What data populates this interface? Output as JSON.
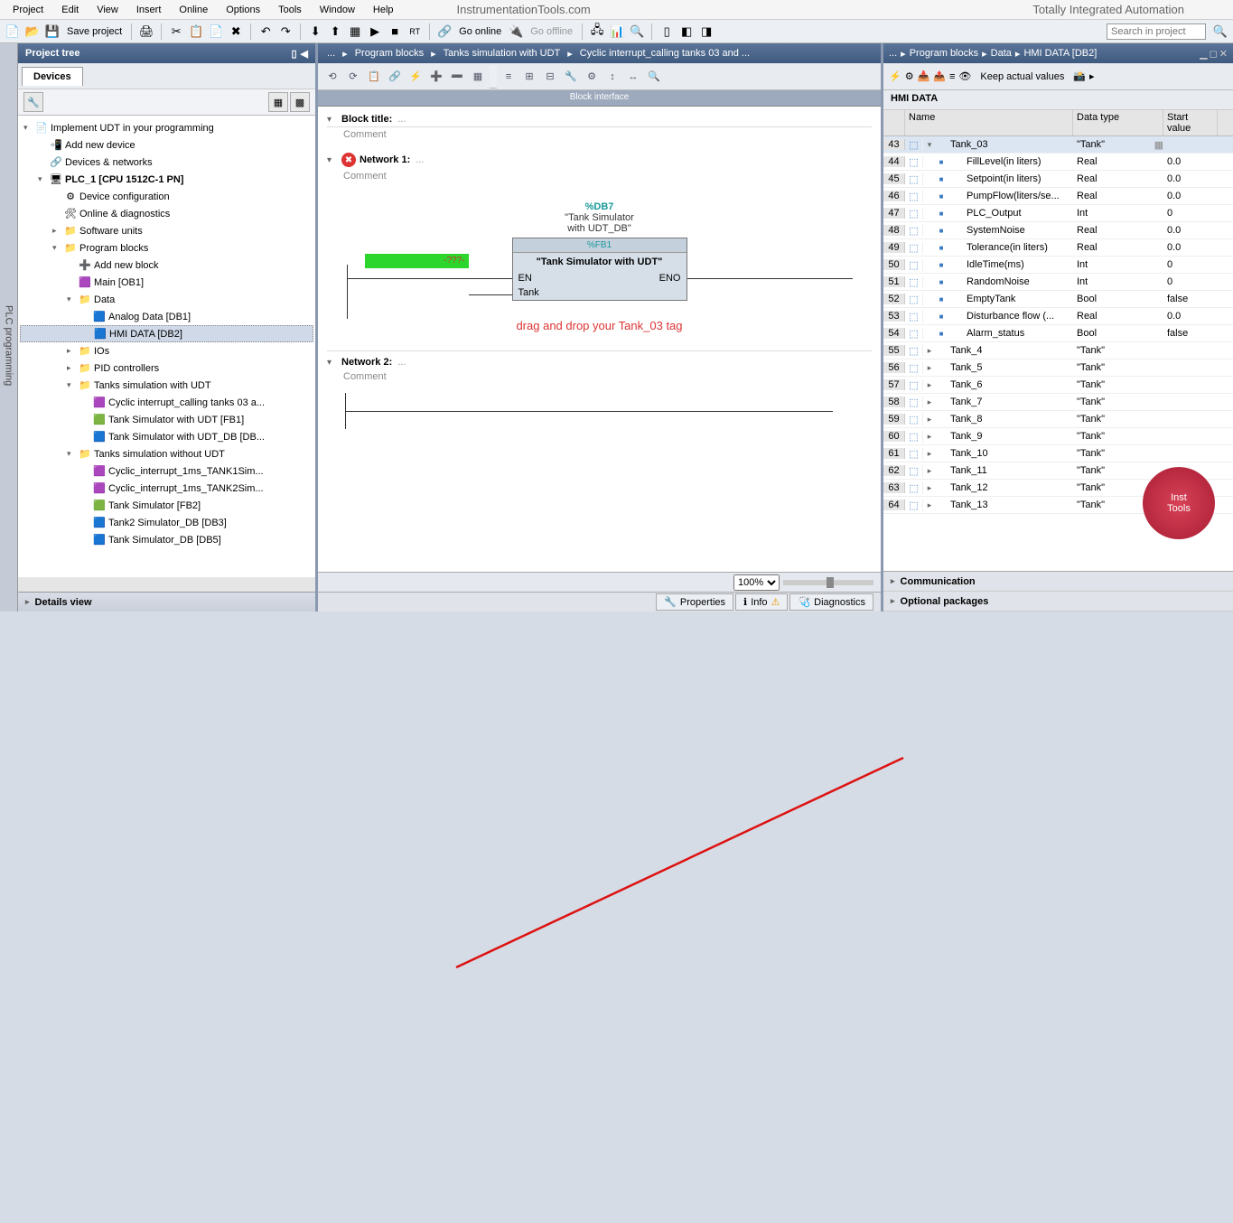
{
  "menu": [
    "Project",
    "Edit",
    "View",
    "Insert",
    "Online",
    "Options",
    "Tools",
    "Window",
    "Help"
  ],
  "site_title": "InstrumentationTools.com",
  "app_title": "Totally Integrated Automation",
  "toolbar": {
    "save": "Save project",
    "go_online": "Go online",
    "go_offline": "Go offline",
    "search_placeholder": "Search in project"
  },
  "left": {
    "title": "Project tree",
    "tab": "Devices",
    "details": "Details view",
    "tree": [
      {
        "d": 0,
        "exp": "▾",
        "icon": "📄",
        "label": "Implement UDT in your programming"
      },
      {
        "d": 1,
        "exp": "",
        "icon": "📲",
        "label": "Add new device"
      },
      {
        "d": 1,
        "exp": "",
        "icon": "🔗",
        "label": "Devices & networks"
      },
      {
        "d": 1,
        "exp": "▾",
        "icon": "🖥",
        "label": "PLC_1 [CPU 1512C-1 PN]",
        "bold": true
      },
      {
        "d": 2,
        "exp": "",
        "icon": "⚙",
        "label": "Device configuration"
      },
      {
        "d": 2,
        "exp": "",
        "icon": "🛠",
        "label": "Online & diagnostics"
      },
      {
        "d": 2,
        "exp": "▸",
        "icon": "📁",
        "label": "Software units"
      },
      {
        "d": 2,
        "exp": "▾",
        "icon": "📁",
        "label": "Program blocks"
      },
      {
        "d": 3,
        "exp": "",
        "icon": "➕",
        "label": "Add new block"
      },
      {
        "d": 3,
        "exp": "",
        "icon": "🟪",
        "label": "Main [OB1]"
      },
      {
        "d": 3,
        "exp": "▾",
        "icon": "📁",
        "label": "Data"
      },
      {
        "d": 4,
        "exp": "",
        "icon": "🟦",
        "label": "Analog Data [DB1]"
      },
      {
        "d": 4,
        "exp": "",
        "icon": "🟦",
        "label": "HMI DATA [DB2]",
        "selected": true
      },
      {
        "d": 3,
        "exp": "▸",
        "icon": "📁",
        "label": "IOs"
      },
      {
        "d": 3,
        "exp": "▸",
        "icon": "📁",
        "label": "PID controllers"
      },
      {
        "d": 3,
        "exp": "▾",
        "icon": "📁",
        "label": "Tanks simulation with UDT"
      },
      {
        "d": 4,
        "exp": "",
        "icon": "🟪",
        "label": "Cyclic interrupt_calling tanks 03 a..."
      },
      {
        "d": 4,
        "exp": "",
        "icon": "🟩",
        "label": "Tank Simulator with UDT [FB1]"
      },
      {
        "d": 4,
        "exp": "",
        "icon": "🟦",
        "label": "Tank Simulator with UDT_DB [DB..."
      },
      {
        "d": 3,
        "exp": "▾",
        "icon": "📁",
        "label": "Tanks simulation without UDT"
      },
      {
        "d": 4,
        "exp": "",
        "icon": "🟪",
        "label": "Cyclic_interrupt_1ms_TANK1Sim..."
      },
      {
        "d": 4,
        "exp": "",
        "icon": "🟪",
        "label": "Cyclic_interrupt_1ms_TANK2Sim..."
      },
      {
        "d": 4,
        "exp": "",
        "icon": "🟩",
        "label": "Tank Simulator [FB2]"
      },
      {
        "d": 4,
        "exp": "",
        "icon": "🟦",
        "label": "Tank2 Simulator_DB [DB3]"
      },
      {
        "d": 4,
        "exp": "",
        "icon": "🟦",
        "label": "Tank Simulator_DB [DB5]"
      }
    ]
  },
  "center": {
    "breadcrumb": [
      "...",
      "Program blocks",
      "Tanks simulation with UDT",
      "Cyclic interrupt_calling tanks 03 and ..."
    ],
    "block_interface": "Block interface",
    "block_title": "Block title:",
    "comment": "Comment",
    "net1": "Network 1:",
    "net2": "Network 2:",
    "db_tag": "%DB7",
    "db_name1": "\"Tank Simulator",
    "db_name2": "with UDT_DB\"",
    "fb_tag": "%FB1",
    "fb_name": "\"Tank Simulator with UDT\"",
    "en": "EN",
    "eno": "ENO",
    "tank": "Tank",
    "green": "-???-",
    "annotation": "drag and drop your Tank_03 tag",
    "zoom": "100%",
    "tabs": {
      "properties": "Properties",
      "info": "Info",
      "diagnostics": "Diagnostics"
    }
  },
  "right": {
    "breadcrumb": [
      "Program blocks",
      "Data",
      "HMI DATA [DB2]"
    ],
    "keep": "Keep actual values",
    "title": "HMI DATA",
    "headers": {
      "name": "Name",
      "type": "Data type",
      "start": "Start value"
    },
    "rows": [
      {
        "n": 43,
        "exp": "▾",
        "name": "Tank_03",
        "type": "\"Tank\"",
        "val": "",
        "hl": true,
        "top": true
      },
      {
        "n": 44,
        "name": "FillLevel(in liters)",
        "type": "Real",
        "val": "0.0",
        "child": true
      },
      {
        "n": 45,
        "name": "Setpoint(in liters)",
        "type": "Real",
        "val": "0.0",
        "child": true
      },
      {
        "n": 46,
        "name": "PumpFlow(liters/se...",
        "type": "Real",
        "val": "0.0",
        "child": true
      },
      {
        "n": 47,
        "name": "PLC_Output",
        "type": "Int",
        "val": "0",
        "child": true
      },
      {
        "n": 48,
        "name": "SystemNoise",
        "type": "Real",
        "val": "0.0",
        "child": true
      },
      {
        "n": 49,
        "name": "Tolerance(in liters)",
        "type": "Real",
        "val": "0.0",
        "child": true
      },
      {
        "n": 50,
        "name": "IdleTime(ms)",
        "type": "Int",
        "val": "0",
        "child": true
      },
      {
        "n": 51,
        "name": "RandomNoise",
        "type": "Int",
        "val": "0",
        "child": true
      },
      {
        "n": 52,
        "name": "EmptyTank",
        "type": "Bool",
        "val": "false",
        "child": true
      },
      {
        "n": 53,
        "name": "Disturbance flow (...",
        "type": "Real",
        "val": "0.0",
        "child": true
      },
      {
        "n": 54,
        "name": "Alarm_status",
        "type": "Bool",
        "val": "false",
        "child": true
      },
      {
        "n": 55,
        "exp": "▸",
        "name": "Tank_4",
        "type": "\"Tank\"",
        "val": "",
        "top": true
      },
      {
        "n": 56,
        "exp": "▸",
        "name": "Tank_5",
        "type": "\"Tank\"",
        "val": "",
        "top": true
      },
      {
        "n": 57,
        "exp": "▸",
        "name": "Tank_6",
        "type": "\"Tank\"",
        "val": "",
        "top": true
      },
      {
        "n": 58,
        "exp": "▸",
        "name": "Tank_7",
        "type": "\"Tank\"",
        "val": "",
        "top": true
      },
      {
        "n": 59,
        "exp": "▸",
        "name": "Tank_8",
        "type": "\"Tank\"",
        "val": "",
        "top": true
      },
      {
        "n": 60,
        "exp": "▸",
        "name": "Tank_9",
        "type": "\"Tank\"",
        "val": "",
        "top": true
      },
      {
        "n": 61,
        "exp": "▸",
        "name": "Tank_10",
        "type": "\"Tank\"",
        "val": "",
        "top": true
      },
      {
        "n": 62,
        "exp": "▸",
        "name": "Tank_11",
        "type": "\"Tank\"",
        "val": "",
        "top": true
      },
      {
        "n": 63,
        "exp": "▸",
        "name": "Tank_12",
        "type": "\"Tank\"",
        "val": "",
        "top": true
      },
      {
        "n": 64,
        "exp": "▸",
        "name": "Tank_13",
        "type": "\"Tank\"",
        "val": "",
        "top": true
      }
    ],
    "bottom_tabs": [
      "Communication",
      "Optional packages"
    ]
  },
  "logo": {
    "l1": "Inst",
    "l2": "Tools"
  },
  "sidebar_label": "PLC programming"
}
